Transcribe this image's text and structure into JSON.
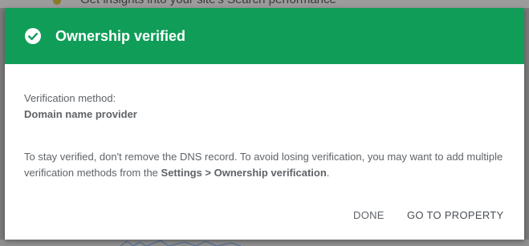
{
  "background": {
    "partial_text": "Get insights into your site's Search performance"
  },
  "dialog": {
    "title": "Ownership verified",
    "header_color": "#0f9d58",
    "header_icon": "check-circle-icon",
    "method_label": "Verification method:",
    "method_value": "Domain name provider",
    "info_prefix": "To stay verified, don't remove the DNS record. To avoid losing verification, you may want to add multiple verification methods from the ",
    "info_link": "Settings > Ownership verification",
    "info_suffix": ".",
    "buttons": {
      "done": "DONE",
      "go_to_property": "GO TO PROPERTY"
    }
  }
}
